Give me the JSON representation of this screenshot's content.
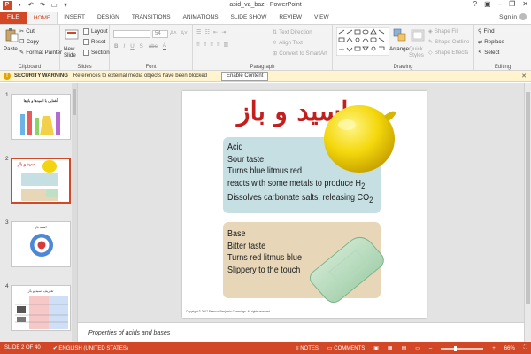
{
  "window": {
    "title": "asid_va_baz - PowerPoint",
    "signin": "Sign in"
  },
  "tabs": [
    "FILE",
    "HOME",
    "INSERT",
    "DESIGN",
    "TRANSITIONS",
    "ANIMATIONS",
    "SLIDE SHOW",
    "REVIEW",
    "VIEW"
  ],
  "ribbon": {
    "clipboard": {
      "paste": "Paste",
      "cut": "Cut",
      "copy": "Copy",
      "format_painter": "Format Painter",
      "label": "Clipboard"
    },
    "slides": {
      "new_slide": "New Slide",
      "layout": "Layout",
      "reset": "Reset",
      "section": "Section",
      "label": "Slides"
    },
    "font": {
      "font_name": "",
      "font_size": "54",
      "label": "Font"
    },
    "paragraph": {
      "text_direction": "Text Direction",
      "align_text": "Align Text",
      "convert_smartart": "Convert to SmartArt",
      "label": "Paragraph"
    },
    "drawing": {
      "arrange": "Arrange",
      "quick_styles": "Quick Styles",
      "shape_fill": "Shape Fill",
      "shape_outline": "Shape Outline",
      "shape_effects": "Shape Effects",
      "label": "Drawing"
    },
    "editing": {
      "find": "Find",
      "replace": "Replace",
      "select": "Select",
      "label": "Editing"
    }
  },
  "security": {
    "title": "SECURITY WARNING",
    "message": "References to external media objects have been blocked",
    "button": "Enable Content"
  },
  "thumbnails": {
    "numbers": [
      "1",
      "2",
      "3",
      "4"
    ],
    "slide1_title": "آشنایی با اسیدها و بازها",
    "slide2_title": "اسید و باز",
    "slide3_title": "اسید باز",
    "slide4_title": "تعاریف اسید و باز"
  },
  "slide": {
    "title": "اسید و باز",
    "acid_lines": [
      "Acid",
      "Sour taste",
      "Turns blue litmus red",
      "reacts with some metals to produce H",
      "Dissolves carbonate salts, releasing CO"
    ],
    "subscript": "2",
    "base_lines": [
      "Base",
      "Bitter taste",
      "Turns red litmus blue",
      "Slippery to the touch"
    ],
    "copyright": "Copyright © 2007 Pearson Benjamin Cummings.  All rights reserved."
  },
  "notes": {
    "text": "Properties of acids and bases"
  },
  "status": {
    "slide_count": "SLIDE 2 OF 40",
    "language": "ENGLISH (UNITED STATES)",
    "notes": "NOTES",
    "comments": "COMMENTS",
    "zoom": "66%",
    "zoom_fraction": 0.66
  },
  "colors": {
    "accent": "#d24726",
    "title_red": "#c41f1f",
    "acid_box": "#c5dfe3",
    "base_box": "#e7d7b8"
  }
}
